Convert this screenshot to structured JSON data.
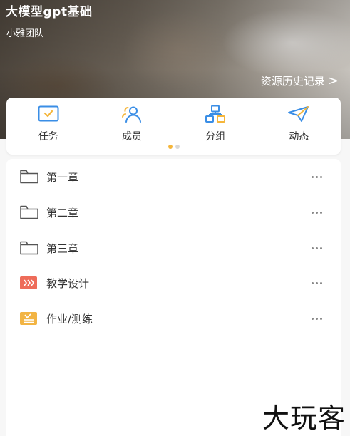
{
  "header": {
    "title": "大模型gpt基础",
    "team": "小雅团队",
    "history_link": "资源历史记录",
    "history_chevron": ">"
  },
  "tabs": [
    {
      "label": "任务",
      "icon": "task-icon",
      "color": "#3a8ee6"
    },
    {
      "label": "成员",
      "icon": "members-icon",
      "color": "#3a8ee6"
    },
    {
      "label": "分组",
      "icon": "group-icon",
      "color": "#3a8ee6"
    },
    {
      "label": "动态",
      "icon": "activity-icon",
      "color": "#3a8ee6"
    }
  ],
  "pager": {
    "pages": 2,
    "active": 1,
    "active_color": "#f5b63b"
  },
  "resources": [
    {
      "label": "第一章",
      "icon": "folder-icon"
    },
    {
      "label": "第二章",
      "icon": "folder-icon"
    },
    {
      "label": "第三章",
      "icon": "folder-icon"
    },
    {
      "label": "教学设计",
      "icon": "teaching-design-icon",
      "color": "#ee6c5a"
    },
    {
      "label": "作业/测练",
      "icon": "homework-icon",
      "color": "#f2b443"
    }
  ],
  "watermark": "大玩客"
}
